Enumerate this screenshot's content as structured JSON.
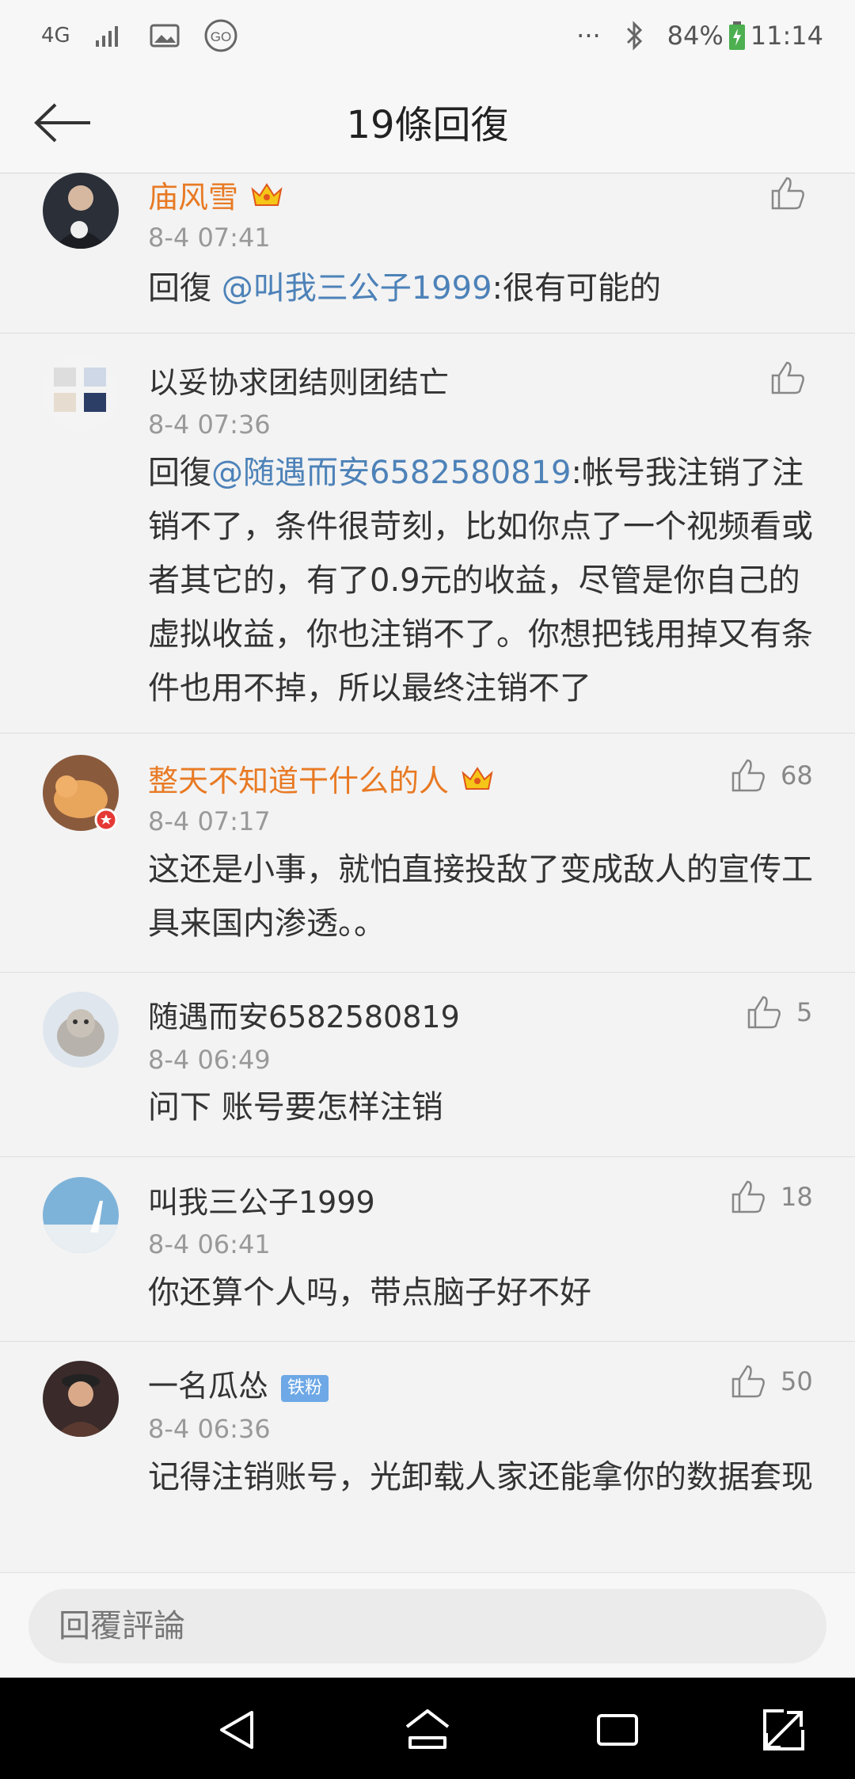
{
  "status_bar": {
    "network": "4G",
    "dots": "···",
    "battery": "84%",
    "time": "11:14"
  },
  "header": {
    "title": "19條回復"
  },
  "comments": [
    {
      "name": "庙风雪",
      "time": "8-4 07:41",
      "prefix": "回復 ",
      "mention": "@叫我三公子1999",
      "text": ":很有可能的",
      "likes": ""
    },
    {
      "name": "以妥协求团结则团结亡",
      "time": "8-4 07:36",
      "prefix": "回復",
      "mention": "@随遇而安6582580819",
      "text": ":帐号我注销了注销不了，条件很苛刻，比如你点了一个视频看或者其它的，有了0.9元的收益，尽管是你自己的虚拟收益，你也注销不了。你想把钱用掉又有条件也用不掉，所以最终注销不了",
      "likes": ""
    },
    {
      "name": "整天不知道干什么的人",
      "time": "8-4 07:17",
      "text": " 这还是小事，就怕直接投敌了变成敌人的宣传工具来国内渗透。。",
      "likes": "68"
    },
    {
      "name": "随遇而安6582580819",
      "time": "8-4 06:49",
      "text": "问下 账号要怎样注销",
      "likes": "5"
    },
    {
      "name": "叫我三公子1999",
      "time": "8-4 06:41",
      "text": "你还算个人吗，带点脑子好不好",
      "likes": "18"
    },
    {
      "name": "一名瓜怂",
      "badge": "铁粉",
      "time": "8-4 06:36",
      "text": "记得注销账号，光卸载人家还能拿你的数据套现",
      "likes": "50"
    }
  ],
  "reply_bar": {
    "placeholder": "回覆評論"
  },
  "colors": {
    "vip_name": "#e87a24",
    "mention": "#4d82b8",
    "badge": "#6ea8e6"
  }
}
